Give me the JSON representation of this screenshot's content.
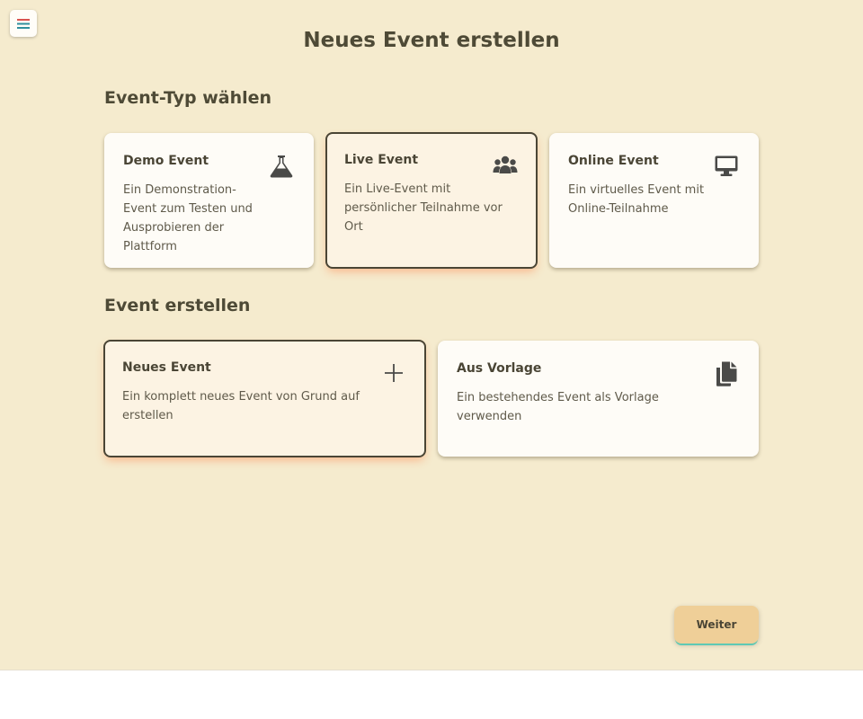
{
  "header": {
    "menu_icon": "hamburger-menu-icon",
    "title": "Neues Event erstellen"
  },
  "event_type": {
    "heading": "Event-Typ wählen",
    "options": [
      {
        "title": "Demo Event",
        "description": "Ein Demonstration-Event zum Testen und Ausprobieren der Plattform",
        "icon": "flask-icon",
        "selected": false
      },
      {
        "title": "Live Event",
        "description": "Ein Live-Event mit persönlicher Teilnahme vor Ort",
        "icon": "users-icon",
        "selected": true
      },
      {
        "title": "Online Event",
        "description": "Ein virtuelles Event mit Online-Teilnahme",
        "icon": "monitor-icon",
        "selected": false
      }
    ]
  },
  "create": {
    "heading": "Event erstellen",
    "options": [
      {
        "title": "Neues Event",
        "description": "Ein komplett neues Event von Grund auf erstellen",
        "icon": "plus-icon",
        "selected": true
      },
      {
        "title": "Aus Vorlage",
        "description": "Ein bestehendes Event als Vorlage verwenden",
        "icon": "copy-icon",
        "selected": false
      }
    ]
  },
  "footer": {
    "next_label": "Weiter"
  },
  "colors": {
    "background": "#f5ebce",
    "card": "#fefcf7",
    "card_selected": "#fcf3e3",
    "accent_button": "#efcf98",
    "accent_underline": "#5fc9b4",
    "text": "#4a4535"
  }
}
